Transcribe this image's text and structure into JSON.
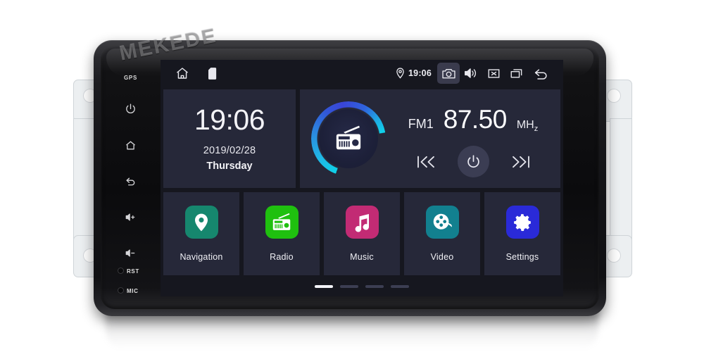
{
  "brand": {
    "watermark": "MEKEDE"
  },
  "hardkeys": {
    "gps_label": "GPS",
    "power": "power-key",
    "home": "home-key",
    "back": "back-key",
    "volume_up": "volume-up-key",
    "volume_down": "volume-down-key",
    "rst_label": "RST",
    "mic_label": "MIC"
  },
  "statusbar": {
    "home_icon": "home-icon",
    "sdcard_icon": "sd-card-icon",
    "location_icon": "location-pin-icon",
    "time": "19:06",
    "camera_icon": "camera-icon",
    "volume_icon": "volume-icon",
    "mute_icon": "mute-x-icon",
    "recents_icon": "recent-apps-icon",
    "back_icon": "back-arrow-icon"
  },
  "clock_widget": {
    "time": "19:06",
    "date": "2019/02/28",
    "weekday": "Thursday"
  },
  "radio_widget": {
    "dial_icon": "radio-icon",
    "band": "FM1",
    "frequency": "87.50",
    "unit": "MHz",
    "unit_main": "MH",
    "unit_sub": "z",
    "prev_icon": "previous-track-icon",
    "power_icon": "power-icon",
    "next_icon": "next-track-icon",
    "ring_color_start": "#0fd0e8",
    "ring_color_end": "#3a45d6"
  },
  "apps": [
    {
      "label": "Navigation",
      "icon": "location-pin-icon",
      "color": "#16876e"
    },
    {
      "label": "Radio",
      "icon": "radio-icon",
      "color": "#1fc00f"
    },
    {
      "label": "Music",
      "icon": "music-note-icon",
      "color": "#c22b74"
    },
    {
      "label": "Video",
      "icon": "film-reel-icon",
      "color": "#12808f"
    },
    {
      "label": "Settings",
      "icon": "gear-icon",
      "color": "#2a2ad8"
    }
  ],
  "pager": {
    "total": 4,
    "active": 1
  },
  "theme": {
    "screen_bg": "#16171f",
    "tile_bg": "#262839",
    "text": "#f0f0f5",
    "bezel": "#121214"
  }
}
